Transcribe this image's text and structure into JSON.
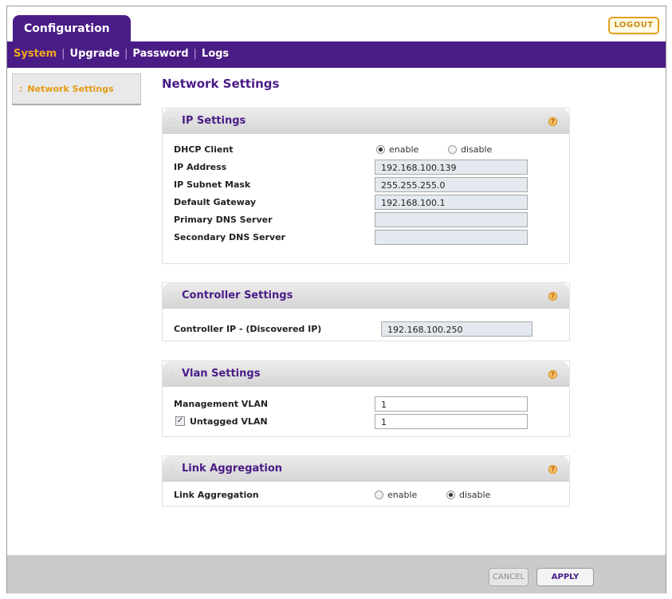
{
  "header": {
    "tab_label": "Configuration",
    "logout_label": "LOGOUT"
  },
  "nav": {
    "items": [
      "System",
      "Upgrade",
      "Password",
      "Logs"
    ]
  },
  "sidebar": {
    "items": [
      {
        "label": "Network Settings"
      }
    ]
  },
  "page_title": "Network Settings",
  "ip_settings": {
    "title": "IP Settings",
    "dhcp_label": "DHCP Client",
    "dhcp_enable": "enable",
    "dhcp_disable": "disable",
    "dhcp_selected": "enable",
    "ip_address_label": "IP Address",
    "ip_address": "192.168.100.139",
    "subnet_label": "IP Subnet Mask",
    "subnet": "255.255.255.0",
    "gateway_label": "Default Gateway",
    "gateway": "192.168.100.1",
    "primary_dns_label": "Primary DNS Server",
    "primary_dns": "",
    "secondary_dns_label": "Secondary DNS Server",
    "secondary_dns": ""
  },
  "controller_settings": {
    "title": "Controller Settings",
    "controller_ip_label": "Controller IP - (Discovered IP)",
    "controller_ip": "192.168.100.250"
  },
  "vlan_settings": {
    "title": "Vlan Settings",
    "mgmt_vlan_label": "Management VLAN",
    "mgmt_vlan": "1",
    "untagged_vlan_label": "Untagged VLAN",
    "untagged_vlan": "1",
    "untagged_checked": true
  },
  "link_aggregation": {
    "title": "Link Aggregation",
    "label": "Link Aggregation",
    "enable": "enable",
    "disable": "disable",
    "selected": "disable"
  },
  "footer": {
    "cancel_label": "CANCEL",
    "apply_label": "APPLY"
  },
  "colors": {
    "brand_purple": "#4a1c86",
    "accent_orange": "#f0a81c"
  },
  "icons": {
    "help": "help-icon",
    "checkbox_checked": "check-icon"
  }
}
